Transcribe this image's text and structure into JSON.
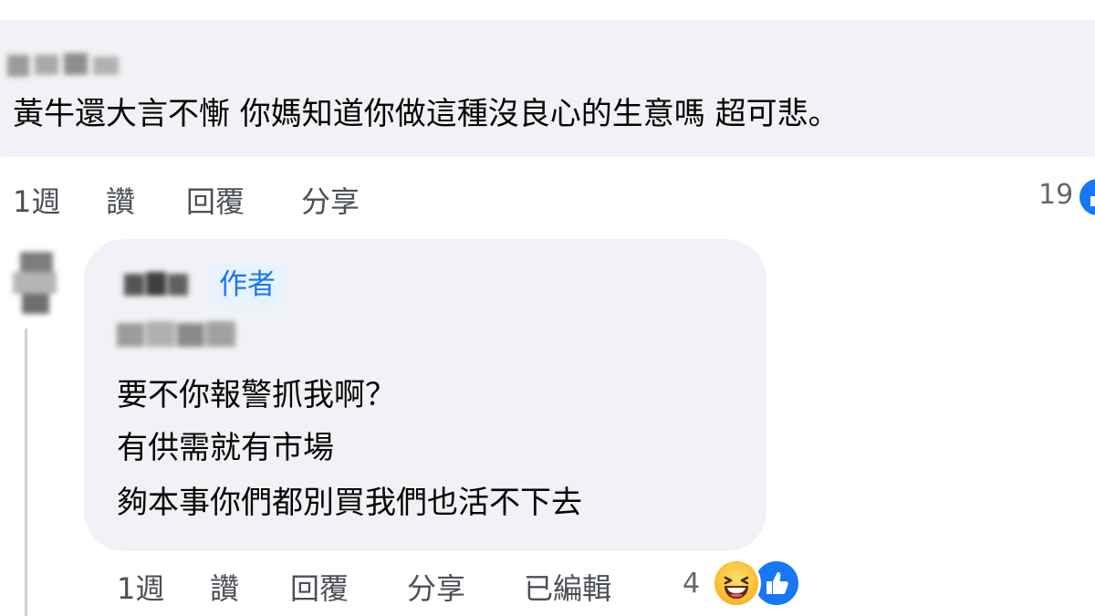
{
  "comment": {
    "text": "黃牛還大言不慚 你媽知道你做這種沒良心的生意嗎 超可悲。",
    "actions": {
      "time": "1週",
      "like": "讚",
      "reply": "回覆",
      "share": "分享"
    },
    "reaction_count": "19",
    "reaction_icons": [
      "like-icon"
    ]
  },
  "reply": {
    "author_badge": "作者",
    "lines": [
      "要不你報警抓我啊？",
      "有供需就有市場",
      "夠本事你們都別買我們也活不下去"
    ],
    "actions": {
      "time": "1週",
      "like": "讚",
      "reply": "回覆",
      "share": "分享",
      "edited": "已編輯"
    },
    "reaction_count": "4",
    "reaction_icons": [
      "haha-icon",
      "like-icon"
    ]
  },
  "colors": {
    "bubble": "#f0f2f5",
    "text": "#050505",
    "meta": "#65676b",
    "facebook_blue": "#1877f2",
    "author_badge_bg": "#e7f3ff"
  }
}
